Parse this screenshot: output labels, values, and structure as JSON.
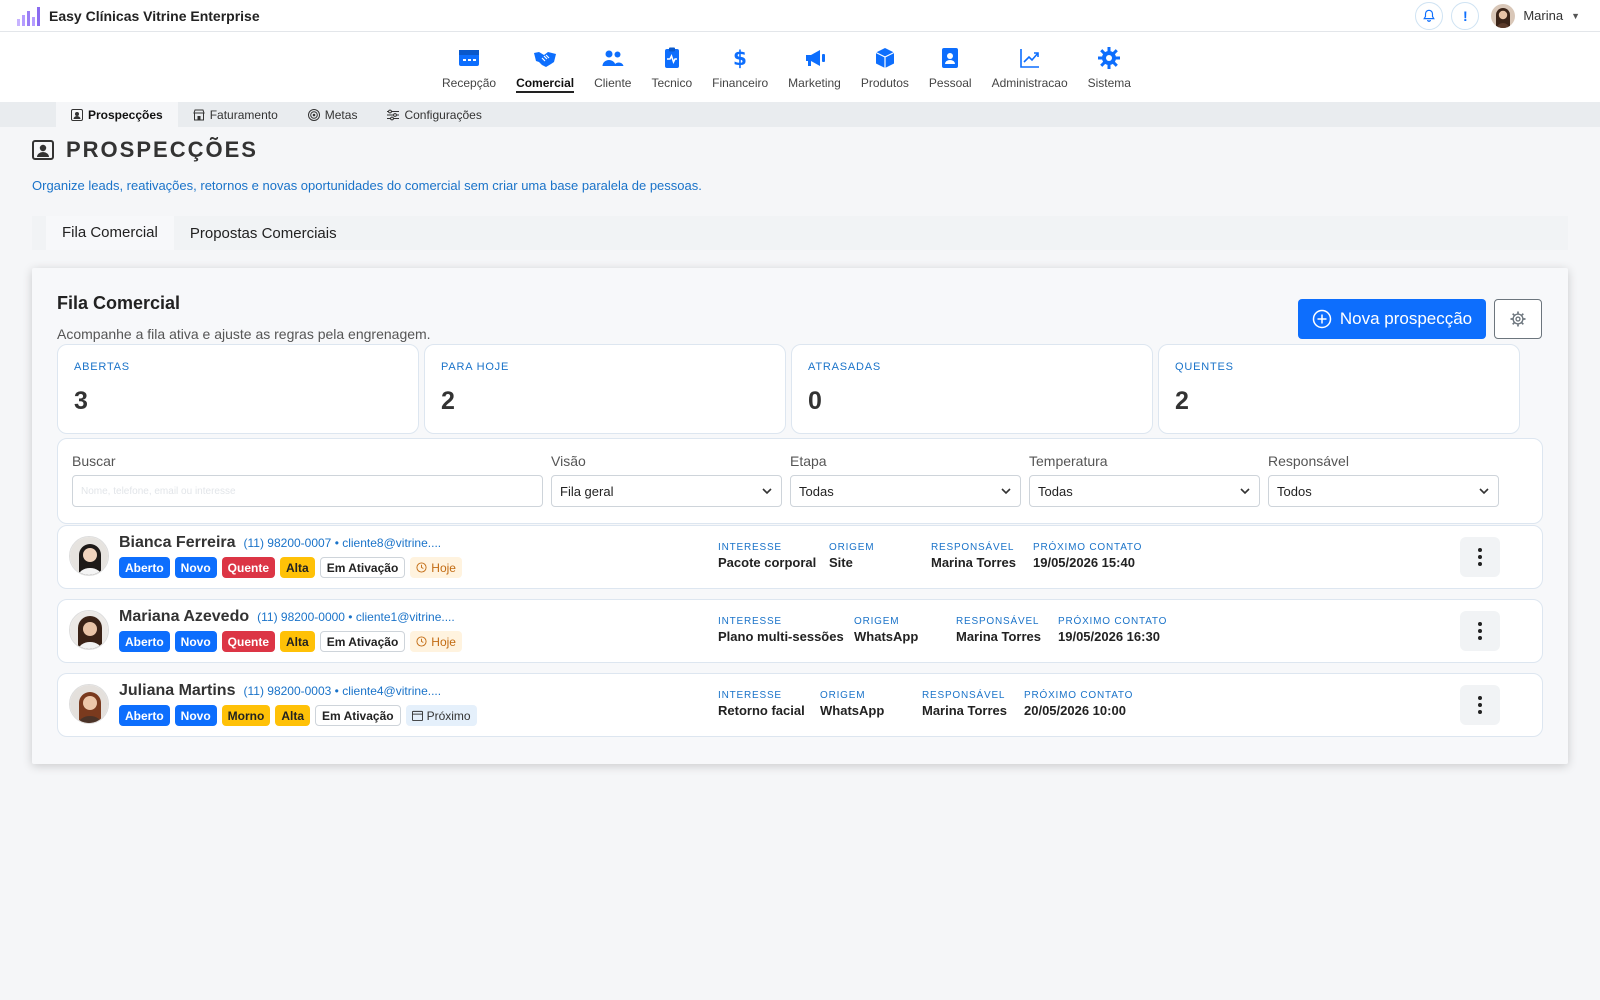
{
  "app": {
    "title": "Easy Clínicas Vitrine Enterprise",
    "user": "Marina",
    "alert_symbol": "!"
  },
  "nav": {
    "items": [
      {
        "label": "Recepção",
        "icon": "reception-icon"
      },
      {
        "label": "Comercial",
        "icon": "handshake-icon",
        "active": true
      },
      {
        "label": "Cliente",
        "icon": "users-icon"
      },
      {
        "label": "Tecnico",
        "icon": "clipboard-pulse-icon"
      },
      {
        "label": "Financeiro",
        "icon": "dollar-icon"
      },
      {
        "label": "Marketing",
        "icon": "megaphone-icon"
      },
      {
        "label": "Produtos",
        "icon": "box-icon"
      },
      {
        "label": "Pessoal",
        "icon": "id-badge-icon"
      },
      {
        "label": "Administracao",
        "icon": "chart-line-icon"
      },
      {
        "label": "Sistema",
        "icon": "gear-icon"
      }
    ]
  },
  "subnav": {
    "items": [
      {
        "label": "Prospecções",
        "active": true
      },
      {
        "label": "Faturamento"
      },
      {
        "label": "Metas"
      },
      {
        "label": "Configurações"
      }
    ]
  },
  "page": {
    "title": "PROSPECÇÕES",
    "description": "Organize leads, reativações, retornos e novas oportunidades do comercial sem criar uma base paralela de pessoas.",
    "tabs": [
      "Fila Comercial",
      "Propostas Comerciais"
    ]
  },
  "card": {
    "title": "Fila Comercial",
    "subtitle": "Acompanhe a fila ativa e ajuste as regras pela engrenagem.",
    "new_button": "Nova prospecção"
  },
  "stats": [
    {
      "label": "ABERTAS",
      "value": "3"
    },
    {
      "label": "PARA HOJE",
      "value": "2"
    },
    {
      "label": "ATRASADAS",
      "value": "0"
    },
    {
      "label": "QUENTES",
      "value": "2"
    }
  ],
  "filters": {
    "search": {
      "label": "Buscar",
      "placeholder": "Nome, telefone, email ou interesse"
    },
    "visao": {
      "label": "Visão",
      "value": "Fila geral"
    },
    "etapa": {
      "label": "Etapa",
      "value": "Todas"
    },
    "temperatura": {
      "label": "Temperatura",
      "value": "Todas"
    },
    "responsavel": {
      "label": "Responsável",
      "value": "Todos"
    }
  },
  "columns": {
    "interesse": "INTERESSE",
    "origem": "ORIGEM",
    "responsavel": "RESPONSÁVEL",
    "proximo": "PRÓXIMO CONTATO"
  },
  "rows": [
    {
      "name": "Bianca Ferreira",
      "contact": "(11) 98200-0007 • cliente8@vitrine....",
      "badges": [
        "Aberto",
        "Novo",
        "Quente",
        "Alta",
        "Em Ativação",
        "Hoje"
      ],
      "interesse": "Pacote corporal",
      "origem": "Site",
      "responsavel": "Marina Torres",
      "proximo": "19/05/2026 15:40"
    },
    {
      "name": "Mariana Azevedo",
      "contact": "(11) 98200-0000 • cliente1@vitrine....",
      "badges": [
        "Aberto",
        "Novo",
        "Quente",
        "Alta",
        "Em Ativação",
        "Hoje"
      ],
      "interesse": "Plano multi-sessões",
      "origem": "WhatsApp",
      "responsavel": "Marina Torres",
      "proximo": "19/05/2026 16:30"
    },
    {
      "name": "Juliana Martins",
      "contact": "(11) 98200-0003 • cliente4@vitrine....",
      "badges": [
        "Aberto",
        "Novo",
        "Morno",
        "Alta",
        "Em Ativação",
        "Próximo"
      ],
      "interesse": "Retorno facial",
      "origem": "WhatsApp",
      "responsavel": "Marina Torres",
      "proximo": "20/05/2026 10:00"
    }
  ],
  "colors": {
    "primary": "#0d6efd",
    "danger": "#dc3545",
    "warning": "#ffc107",
    "link": "#1a73c9"
  }
}
